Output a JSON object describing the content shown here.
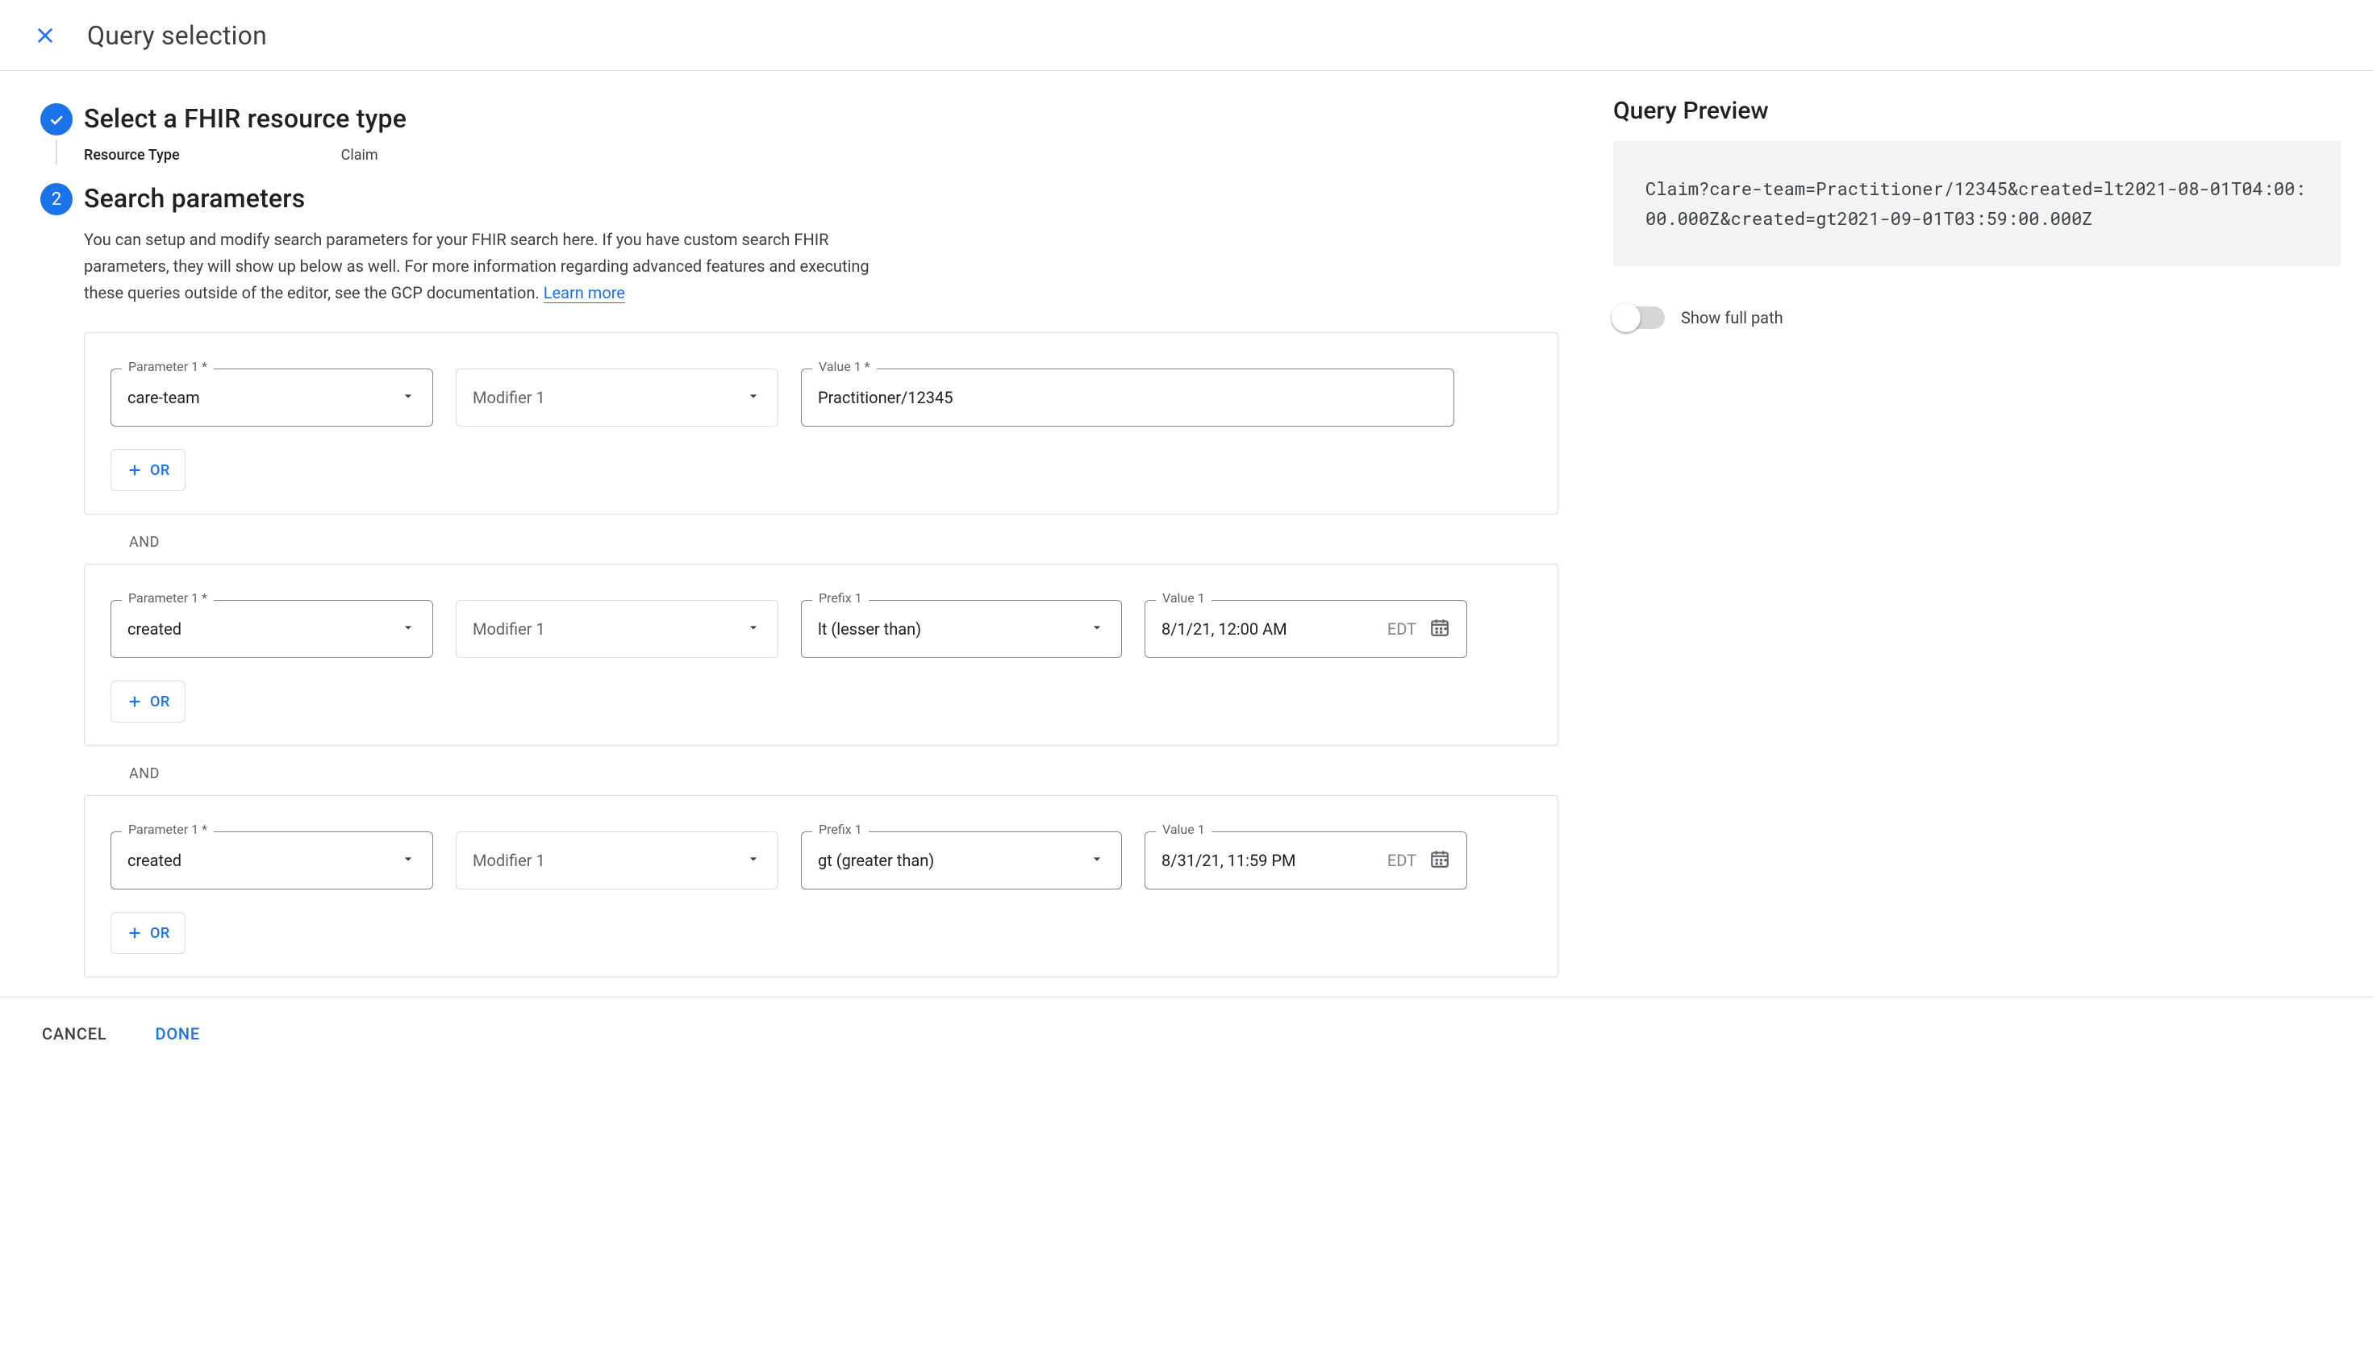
{
  "header": {
    "title": "Query selection"
  },
  "steps": {
    "resource": {
      "title": "Select a FHIR resource type",
      "label": "Resource Type",
      "value": "Claim"
    },
    "params": {
      "title": "Search parameters",
      "help1": "You can setup and modify search parameters for your FHIR search here. If you have custom search FHIR parameters, they will show up below as well. For more information regarding advanced features and executing these queries outside of the editor, see the GCP documentation. ",
      "learn_more": "Learn more"
    }
  },
  "field_labels": {
    "param": "Parameter 1 *",
    "modifier": "Modifier 1",
    "value_req": "Value 1 *",
    "prefix": "Prefix 1",
    "value": "Value 1"
  },
  "groups": [
    {
      "param": "care-team",
      "modifier": "",
      "prefix": "",
      "value": "Practitioner/12345",
      "is_date": false,
      "tz": ""
    },
    {
      "param": "created",
      "modifier": "",
      "prefix": "lt (lesser than)",
      "value": "8/1/21, 12:00 AM",
      "is_date": true,
      "tz": "EDT"
    },
    {
      "param": "created",
      "modifier": "",
      "prefix": "gt (greater than)",
      "value": "8/31/21, 11:59 PM",
      "is_date": true,
      "tz": "EDT"
    }
  ],
  "or_label": "OR",
  "and_label": "AND",
  "preview": {
    "title": "Query Preview",
    "text": "Claim?care-team=Practitioner/12345&created=lt2021-08-01T04:00:00.000Z&created=gt2021-09-01T03:59:00.000Z",
    "toggle_label": "Show full path"
  },
  "footer": {
    "cancel": "CANCEL",
    "done": "DONE"
  }
}
